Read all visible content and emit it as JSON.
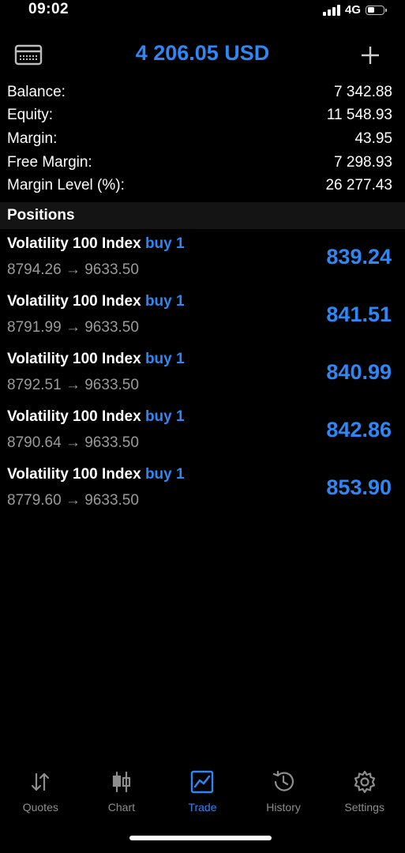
{
  "status": {
    "time": "09:02",
    "network": "4G"
  },
  "header": {
    "title": "4 206.05 USD",
    "left_icon": "account-card-icon",
    "right_icon": "plus-icon"
  },
  "summary": [
    {
      "label": "Balance:",
      "value": "7 342.88"
    },
    {
      "label": "Equity:",
      "value": "11 548.93"
    },
    {
      "label": "Margin:",
      "value": "43.95"
    },
    {
      "label": "Free Margin:",
      "value": "7 298.93"
    },
    {
      "label": "Margin Level (%):",
      "value": "26 277.43"
    }
  ],
  "positions_header": "Positions",
  "positions": [
    {
      "symbol": "Volatility 100 Index",
      "side": "buy 1",
      "prices": "8794.26 → 9633.50",
      "profit": "839.24"
    },
    {
      "symbol": "Volatility 100 Index",
      "side": "buy 1",
      "prices": "8791.99 → 9633.50",
      "profit": "841.51"
    },
    {
      "symbol": "Volatility 100 Index",
      "side": "buy 1",
      "prices": "8792.51 → 9633.50",
      "profit": "840.99"
    },
    {
      "symbol": "Volatility 100 Index",
      "side": "buy 1",
      "prices": "8790.64 → 9633.50",
      "profit": "842.86"
    },
    {
      "symbol": "Volatility 100 Index",
      "side": "buy 1",
      "prices": "8779.60 → 9633.50",
      "profit": "853.90"
    }
  ],
  "tabs": [
    {
      "label": "Quotes",
      "icon": "quotes-arrows-icon",
      "active": false
    },
    {
      "label": "Chart",
      "icon": "candlestick-chart-icon",
      "active": false
    },
    {
      "label": "Trade",
      "icon": "trade-chart-icon",
      "active": true
    },
    {
      "label": "History",
      "icon": "history-clock-icon",
      "active": false
    },
    {
      "label": "Settings",
      "icon": "gear-icon",
      "active": false
    }
  ],
  "colors": {
    "accent": "#2f86f5",
    "background": "#000000",
    "secondary_text": "#9a9a9a",
    "inactive_tab": "#8e8e8e"
  }
}
